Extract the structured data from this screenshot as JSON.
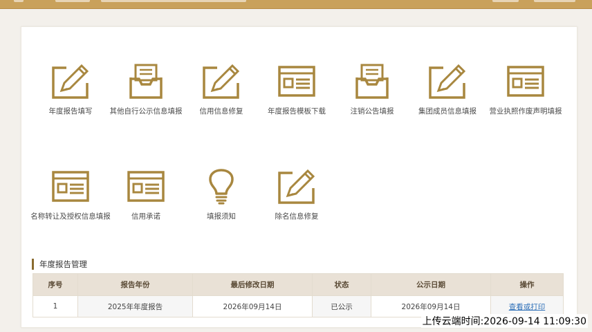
{
  "tiles_row1": [
    {
      "icon": "pencil-edit-icon",
      "label": "年度报告填写"
    },
    {
      "icon": "inbox-tray-icon",
      "label": "其他自行公示信息填报"
    },
    {
      "icon": "pencil-edit-icon",
      "label": "信用信息修复"
    },
    {
      "icon": "form-window-icon",
      "label": "年度报告模板下载"
    },
    {
      "icon": "inbox-tray-icon",
      "label": "注销公告填报"
    },
    {
      "icon": "pencil-edit-icon",
      "label": "集团成员信息填报"
    },
    {
      "icon": "form-window-icon",
      "label": "营业执照作废声明填报"
    }
  ],
  "tiles_row2": [
    {
      "icon": "form-window-icon",
      "label": "名称转让及授权信息填报"
    },
    {
      "icon": "form-window-icon",
      "label": "信用承诺"
    },
    {
      "icon": "lightbulb-icon",
      "label": "填报须知"
    },
    {
      "icon": "pencil-edit-icon",
      "label": "除名信息修复"
    }
  ],
  "section": {
    "title": "年度报告管理"
  },
  "table": {
    "headers": [
      "序号",
      "报告年份",
      "最后修改日期",
      "状态",
      "公示日期",
      "操作"
    ],
    "rows": [
      [
        "1",
        "2025年年度报告",
        "2026年09月14日",
        "已公示",
        "2026年09月14日",
        "查看或打印"
      ]
    ]
  },
  "timestamp": "上传云端时间:2026-09-14 11:09:30",
  "colors": {
    "accent": "#a8873f",
    "header_bar": "#c9a15b"
  }
}
